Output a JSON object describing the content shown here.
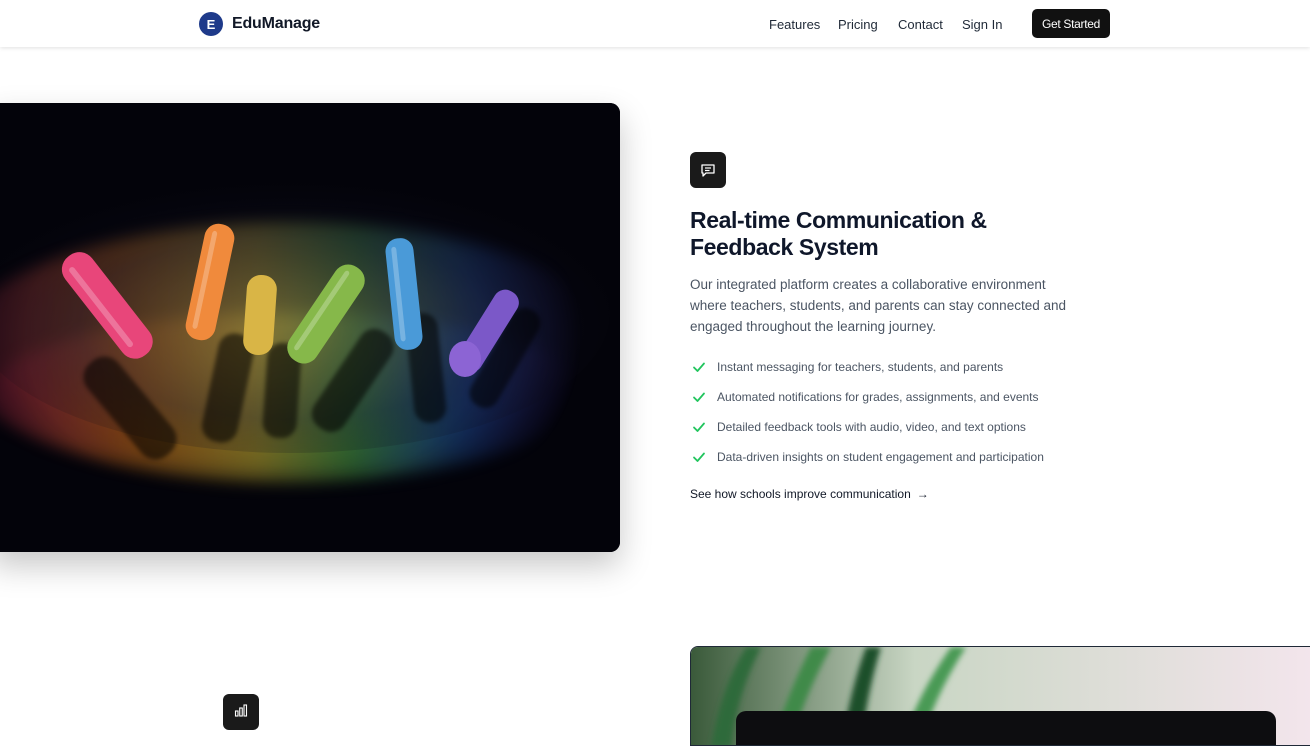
{
  "header": {
    "brand": {
      "logo_letter": "E",
      "name": "EduManage"
    },
    "nav": {
      "features": "Features",
      "pricing": "Pricing",
      "contact": "Contact",
      "sign_in": "Sign In"
    },
    "cta_label": "Get Started"
  },
  "feature": {
    "icon": "message-square-icon",
    "title": "Real-time Communication & Feedback System",
    "description": "Our integrated platform creates a collaborative environment where teachers, students, and parents can stay connected and engaged throughout the learning journey.",
    "bullets": [
      "Instant messaging for teachers, students, and parents",
      "Automated notifications for grades, assignments, and events",
      "Detailed feedback tools with audio, video, and text options",
      "Data-driven insights on student engagement and participation"
    ],
    "link_label": "See how schools improve communication",
    "link_arrow": "→"
  },
  "next_section": {
    "icon": "bar-chart-icon"
  },
  "colors": {
    "accent_dark": "#111111",
    "brand_blue": "#1e3a8a",
    "check_green": "#22c55e",
    "body_text": "#4b5563"
  }
}
